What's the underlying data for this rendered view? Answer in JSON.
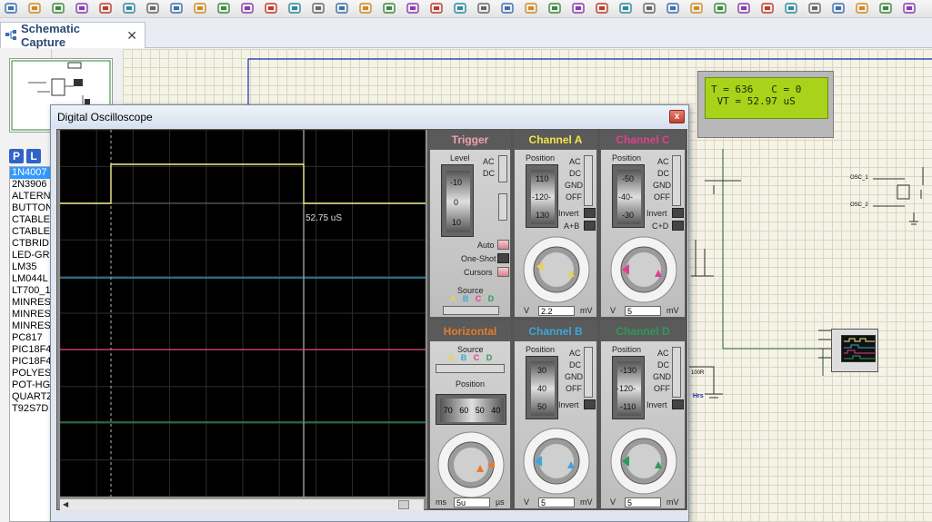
{
  "app": {
    "tab_label": "Schematic Capture",
    "tab_icon": "schematic-icon"
  },
  "toolbar_icons": [
    "open-icon",
    "save-icon",
    "import-icon",
    "home-icon",
    "component-icon",
    "chip-icon",
    "back-icon",
    "page-icon",
    "bom-icon",
    "dollar-icon",
    "gerber-icon",
    "help-icon",
    "refresh-icon",
    "grid-icon",
    "origin-icon",
    "pan-icon",
    "zoom-in-icon",
    "zoom-out-icon",
    "zoom-all-icon",
    "zoom-area-icon",
    "undo-icon",
    "redo-icon",
    "cut-icon",
    "copy-icon",
    "paste-icon",
    "block-copy-icon",
    "block-move-icon",
    "block-rotate-icon",
    "block-delete-icon",
    "pick-icon",
    "make-device-icon",
    "package-icon",
    "decompose-icon",
    "wire-icon",
    "search-icon",
    "property-icon",
    "new-sheet-icon",
    "remove-sheet-icon",
    "exit-icon"
  ],
  "left_panel": {
    "p_button": "P",
    "l_button": "L",
    "devices": [
      "1N4007",
      "2N3906",
      "ALTERN",
      "BUTTON",
      "CTABLE",
      "CTABLE",
      "CTBRID",
      "LED-GR",
      "LM35",
      "LM044L",
      "LT700_1",
      "MINRES",
      "MINRES",
      "MINRES",
      "PC817",
      "PIC18F4",
      "PIC18F4",
      "POLYES",
      "POT-HG",
      "QUARTZ",
      "T92S7D"
    ],
    "selected_index": 0
  },
  "lcd": {
    "line1": "T = 636   C = 0",
    "line2": " VT = 52.97 uS",
    "backlight": "#a7d31b"
  },
  "oscilloscope": {
    "title": "Digital Oscilloscope",
    "close_label": "x",
    "cursor_readout": "52.75 uS",
    "trace_colors": {
      "A": "#f5f08a",
      "B": "#3da6d8",
      "C": "#e0408a",
      "D": "#2e9a5a"
    },
    "trigger": {
      "title": "Trigger",
      "level_label": "Level",
      "level_scale": [
        "-10",
        "0",
        "10"
      ],
      "ac": "AC",
      "dc": "DC",
      "auto": "Auto",
      "one_shot": "One-Shot",
      "cursors": "Cursors",
      "source_label": "Source",
      "source_channels": [
        "A",
        "B",
        "C",
        "D"
      ]
    },
    "channel_a": {
      "title": "Channel A",
      "position_label": "Position",
      "scale": [
        "110",
        "-120-",
        "130"
      ],
      "modes": [
        "AC",
        "DC",
        "GND",
        "OFF"
      ],
      "invert": "Invert",
      "combine": "A+B",
      "knob_labels": [
        "0.5",
        "0.2",
        "0.1",
        "1",
        "2",
        "5",
        "10",
        "20",
        "50",
        "20",
        "10",
        "5",
        "2",
        "1"
      ],
      "value": "2.2",
      "unit_left": "V",
      "unit_right": "mV"
    },
    "channel_c": {
      "title": "Channel C",
      "position_label": "Position",
      "scale": [
        "-50",
        "-40-",
        "-30"
      ],
      "modes": [
        "AC",
        "DC",
        "GND",
        "OFF"
      ],
      "invert": "Invert",
      "combine": "C+D",
      "value": "5",
      "unit_left": "V",
      "unit_right": "mV"
    },
    "horizontal": {
      "title": "Horizontal",
      "source_label": "Source",
      "source_channels": [
        "A",
        "B",
        "C",
        "D"
      ],
      "position_label": "Position",
      "position_scale": [
        "70",
        "60",
        "50",
        "40"
      ],
      "value": "5u",
      "unit_left": "ms",
      "unit_right": "µs"
    },
    "channel_b": {
      "title": "Channel B",
      "position_label": "Position",
      "scale": [
        "30",
        "40",
        "50"
      ],
      "modes": [
        "AC",
        "DC",
        "GND",
        "OFF"
      ],
      "invert": "Invert",
      "value": "5",
      "unit_left": "V",
      "unit_right": "mV"
    },
    "channel_d": {
      "title": "Channel D",
      "position_label": "Position",
      "scale": [
        "-130",
        "-120-",
        "-110"
      ],
      "modes": [
        "AC",
        "DC",
        "GND",
        "OFF"
      ],
      "invert": "Invert",
      "value": "5",
      "unit_left": "V",
      "unit_right": "mV"
    }
  },
  "schematic_labels": {
    "osc1": "OSC_1",
    "osc2": "OSC_2",
    "res": "100R",
    "hrs": "Hrs"
  }
}
